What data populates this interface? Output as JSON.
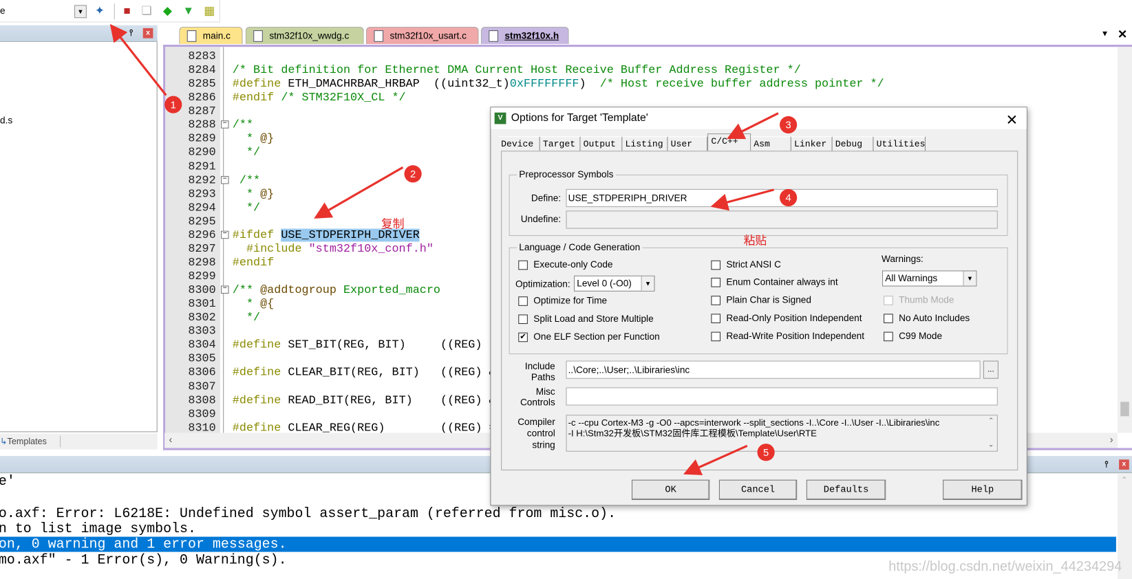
{
  "toolbar": {
    "target_value": "e",
    "icons": [
      "manage-project-items-icon",
      "multi-project-icon",
      "select-packs-icon",
      "pack-installer-icon",
      "manage-rte-icon",
      "options-for-target-icon"
    ]
  },
  "project_panel": {
    "file_fragment": "d.s",
    "bottom_tab": "Templates"
  },
  "editor": {
    "tabs": [
      {
        "label": "main.c",
        "color": "#fde38a"
      },
      {
        "label": "stm32f10x_wwdg.c",
        "color": "#c6d3a0"
      },
      {
        "label": "stm32f10x_usart.c",
        "color": "#f0a8a8"
      },
      {
        "label": "stm32f10x.h",
        "color": "#c7b8e2",
        "active": true
      }
    ],
    "lines": [
      {
        "n": "8283",
        "s": []
      },
      {
        "n": "8284",
        "s": [
          [
            "cm",
            "/* Bit definition for Ethernet DMA Current Host Receive Buffer Address Register */"
          ]
        ]
      },
      {
        "n": "8285",
        "s": [
          [
            "pp",
            "#define"
          ],
          [
            "id",
            " ETH_DMACHRBAR_HRBAP  ((uint32_t)"
          ],
          [
            "hex",
            "0xFFFFFFFF"
          ],
          [
            "id",
            ")  "
          ],
          [
            "cm",
            "/* Host receive buffer address pointer */"
          ]
        ]
      },
      {
        "n": "8286",
        "s": [
          [
            "pp",
            "#endif"
          ],
          [
            "cm",
            " /* STM32F10X_CL */"
          ]
        ]
      },
      {
        "n": "8287",
        "s": []
      },
      {
        "n": "8288",
        "f": true,
        "s": [
          [
            "cm",
            "/**"
          ]
        ]
      },
      {
        "n": "8289",
        "s": [
          [
            "cm",
            "  * "
          ],
          [
            "dt",
            "@}"
          ]
        ]
      },
      {
        "n": "8290",
        "s": [
          [
            "cm",
            "  */"
          ]
        ]
      },
      {
        "n": "8291",
        "s": []
      },
      {
        "n": "8292",
        "f": true,
        "s": [
          [
            "cm",
            " /**"
          ]
        ]
      },
      {
        "n": "8293",
        "s": [
          [
            "cm",
            "  * "
          ],
          [
            "dt",
            "@}"
          ]
        ]
      },
      {
        "n": "8294",
        "s": [
          [
            "cm",
            "  */"
          ]
        ]
      },
      {
        "n": "8295",
        "s": []
      },
      {
        "n": "8296",
        "f": true,
        "s": [
          [
            "pp",
            "#ifdef"
          ],
          [
            "id",
            " "
          ],
          [
            "sel",
            "USE_STDPERIPH_DRIVER"
          ]
        ]
      },
      {
        "n": "8297",
        "s": [
          [
            "pp",
            "  #include"
          ],
          [
            "str",
            " \"stm32f10x_conf.h\""
          ]
        ]
      },
      {
        "n": "8298",
        "s": [
          [
            "pp",
            "#endif"
          ]
        ]
      },
      {
        "n": "8299",
        "s": []
      },
      {
        "n": "8300",
        "f": true,
        "s": [
          [
            "cm",
            "/** "
          ],
          [
            "dt",
            "@addtogroup"
          ],
          [
            "cm",
            " Exported_macro"
          ]
        ]
      },
      {
        "n": "8301",
        "s": [
          [
            "cm",
            "  * "
          ],
          [
            "dt",
            "@{"
          ]
        ]
      },
      {
        "n": "8302",
        "s": [
          [
            "cm",
            "  */"
          ]
        ]
      },
      {
        "n": "8303",
        "s": []
      },
      {
        "n": "8304",
        "s": [
          [
            "pp",
            "#define"
          ],
          [
            "id",
            " SET_BIT(REG, BIT)     ((REG) |"
          ]
        ]
      },
      {
        "n": "8305",
        "s": []
      },
      {
        "n": "8306",
        "s": [
          [
            "pp",
            "#define"
          ],
          [
            "id",
            " CLEAR_BIT(REG, BIT)   ((REG) &"
          ]
        ]
      },
      {
        "n": "8307",
        "s": []
      },
      {
        "n": "8308",
        "s": [
          [
            "pp",
            "#define"
          ],
          [
            "id",
            " READ_BIT(REG, BIT)    ((REG) &"
          ]
        ]
      },
      {
        "n": "8309",
        "s": []
      },
      {
        "n": "8310",
        "s": [
          [
            "pp",
            "#define"
          ],
          [
            "id",
            " CLEAR_REG(REG)        ((REG) ="
          ]
        ]
      }
    ]
  },
  "output": {
    "lines": [
      "e'",
      "",
      "o.axf: Error: L6218E: Undefined symbol assert_param (referred from misc.o).",
      "n to list image symbols.",
      "on, 0 warning and 1 error messages.",
      "mo.axf\" - 1 Error(s), 0 Warning(s)."
    ],
    "highlight_index": 4,
    "watermark": "https://blog.csdn.net/weixin_44234294"
  },
  "dialog": {
    "title": "Options for Target 'Template'",
    "tabs": [
      "Device",
      "Target",
      "Output",
      "Listing",
      "User",
      "C/C++",
      "Asm",
      "Linker",
      "Debug",
      "Utilities"
    ],
    "active_tab": "C/C++",
    "preprocessor": {
      "group": "Preprocessor Symbols",
      "define_label": "Define:",
      "define_value": "USE_STDPERIPH_DRIVER",
      "undefine_label": "Undefine:",
      "undefine_value": ""
    },
    "language": {
      "group": "Language / Code Generation",
      "optimization_label": "Optimization:",
      "optimization_value": "Level 0 (-O0)",
      "warnings_label": "Warnings:",
      "warnings_value": "All Warnings",
      "options": [
        {
          "label": "Execute-only Code",
          "checked": false
        },
        {
          "label": "Optimize for Time",
          "checked": false
        },
        {
          "label": "Split Load and Store Multiple",
          "checked": false
        },
        {
          "label": "One ELF Section per Function",
          "checked": true
        },
        {
          "label": "Strict ANSI C",
          "checked": false
        },
        {
          "label": "Enum Container always int",
          "checked": false
        },
        {
          "label": "Plain Char is Signed",
          "checked": false
        },
        {
          "label": "Read-Only Position Independent",
          "checked": false
        },
        {
          "label": "Read-Write Position Independent",
          "checked": false
        },
        {
          "label": "Thumb Mode",
          "checked": false,
          "disabled": true
        },
        {
          "label": "No Auto Includes",
          "checked": false
        },
        {
          "label": "C99 Mode",
          "checked": false
        }
      ]
    },
    "include_label1": "Include",
    "include_label2": "Paths",
    "include_value": "..\\Core;..\\User;..\\Libiraries\\inc",
    "browse_label": "...",
    "misc_label1": "Misc",
    "misc_label2": "Controls",
    "misc_value": "",
    "compiler_label1": "Compiler",
    "compiler_label2": "control",
    "compiler_label3": "string",
    "compiler_line1": "-c --cpu Cortex-M3 -g -O0 --apcs=interwork --split_sections -I..\\Core -I..\\User -I..\\Libiraries\\inc",
    "compiler_line2": "-I H:\\Stm32开发板\\STM32固件库工程模板\\Template\\User\\RTE",
    "buttons": {
      "ok": "OK",
      "cancel": "Cancel",
      "defaults": "Defaults",
      "help": "Help"
    }
  },
  "annotations": {
    "copy": "复制",
    "paste": "粘贴",
    "steps": [
      "1",
      "2",
      "3",
      "4",
      "5"
    ],
    "color": "#e8322c"
  }
}
